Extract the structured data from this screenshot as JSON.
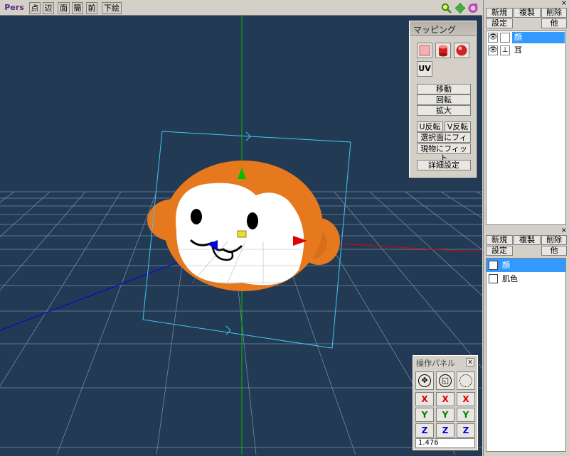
{
  "toolbar": {
    "view_mode": "Pers",
    "buttons": [
      "点",
      "辺",
      "面",
      "簡",
      "前",
      "下絵"
    ],
    "icons": [
      "magnify-icon",
      "move-view-icon",
      "rotate-view-icon"
    ]
  },
  "mapping_panel": {
    "title": "マッピング",
    "shapes": [
      "plane",
      "cylinder",
      "sphere"
    ],
    "uv_label": "UV",
    "buttons": {
      "move": "移動",
      "rotate": "回転",
      "scale": "拡大",
      "u_flip": "U反転",
      "v_flip": "V反転",
      "fit_selected": "選択面にフィット",
      "fit_current": "現物にフィット",
      "details": "詳細設定"
    }
  },
  "control_panel": {
    "title": "操作パネル",
    "close_label": "x",
    "axes": [
      {
        "label": "X",
        "axis": "x"
      },
      {
        "label": "Y",
        "axis": "y"
      },
      {
        "label": "Z",
        "axis": "z"
      }
    ],
    "value": "1.476"
  },
  "object_panel": {
    "close_label": "×",
    "buttons": {
      "new": "新規",
      "copy": "複製",
      "delete": "削除",
      "settings": "設定",
      "other": "他"
    },
    "objects": [
      {
        "name": "顔",
        "selected": true,
        "eye": "👁",
        "lock": ""
      },
      {
        "name": "耳",
        "selected": false,
        "eye": "👁",
        "lock": "⊥"
      }
    ]
  },
  "material_panel": {
    "close_label": "×",
    "buttons": {
      "new": "新規",
      "copy": "複製",
      "delete": "削除",
      "settings": "設定",
      "other": "他"
    },
    "materials": [
      {
        "name": "顔",
        "selected": true
      },
      {
        "name": "肌色",
        "selected": false
      }
    ]
  },
  "colors": {
    "viewport_bg": "#233a55",
    "grid": "#8da3b8",
    "model_orange": "#e6781e",
    "axis_x": "#e00000",
    "axis_y": "#00c000",
    "axis_z": "#0000e0",
    "selection": "#3399ff"
  }
}
